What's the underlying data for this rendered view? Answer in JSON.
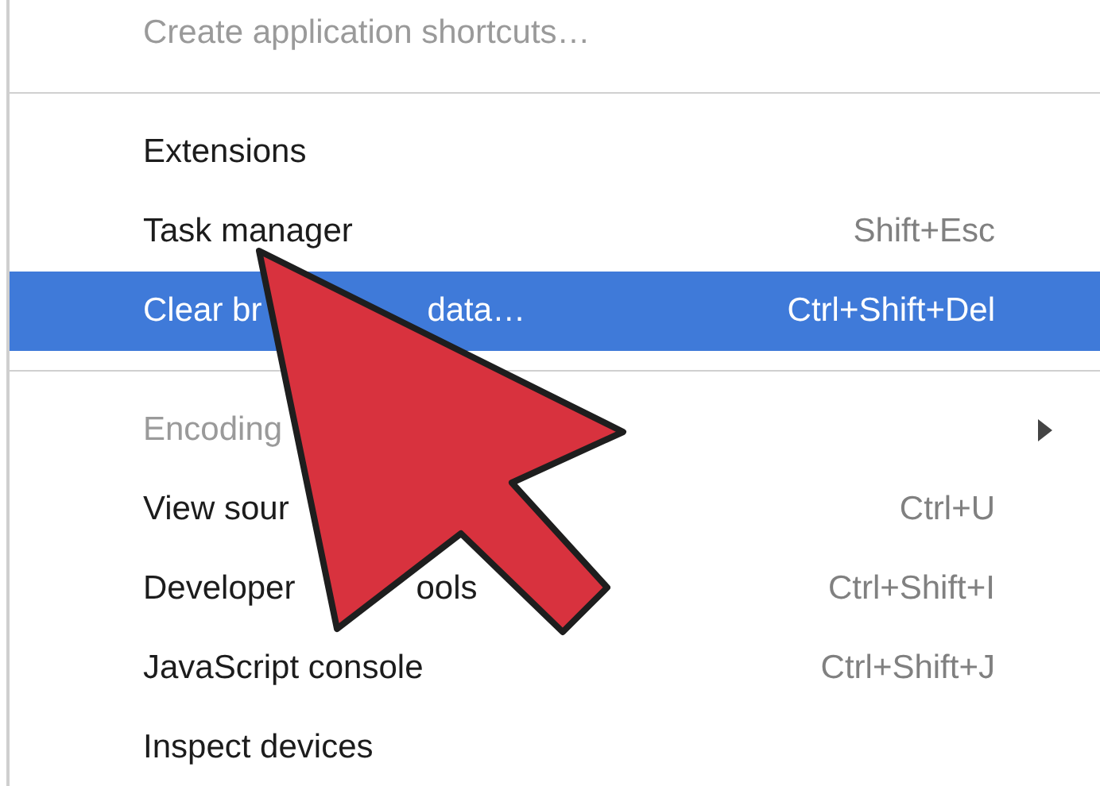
{
  "menu": {
    "items": [
      {
        "kind": "item",
        "label": "Create application shortcuts…",
        "disabled": true,
        "selected": false
      },
      {
        "kind": "separator"
      },
      {
        "kind": "item",
        "label": "Extensions",
        "disabled": false,
        "selected": false
      },
      {
        "kind": "item",
        "label": "Task manager",
        "shortcut": "Shift+Esc",
        "disabled": false,
        "selected": false
      },
      {
        "kind": "item",
        "label": "Clear br",
        "label_end": "data…",
        "shortcut": "Ctrl+Shift+Del",
        "disabled": false,
        "selected": true
      },
      {
        "kind": "separator"
      },
      {
        "kind": "item",
        "label": "Encoding",
        "submenu": true,
        "disabled": true,
        "selected": false
      },
      {
        "kind": "item",
        "label": "View sour",
        "shortcut": "Ctrl+U",
        "disabled": false,
        "selected": false
      },
      {
        "kind": "item",
        "label": "Developer",
        "label_end": "ools",
        "shortcut": "Ctrl+Shift+I",
        "disabled": false,
        "selected": false
      },
      {
        "kind": "item",
        "label": "JavaScript console",
        "shortcut": "Ctrl+Shift+J",
        "disabled": false,
        "selected": false
      },
      {
        "kind": "item",
        "label": "Inspect devices",
        "disabled": false,
        "selected": false
      }
    ]
  }
}
